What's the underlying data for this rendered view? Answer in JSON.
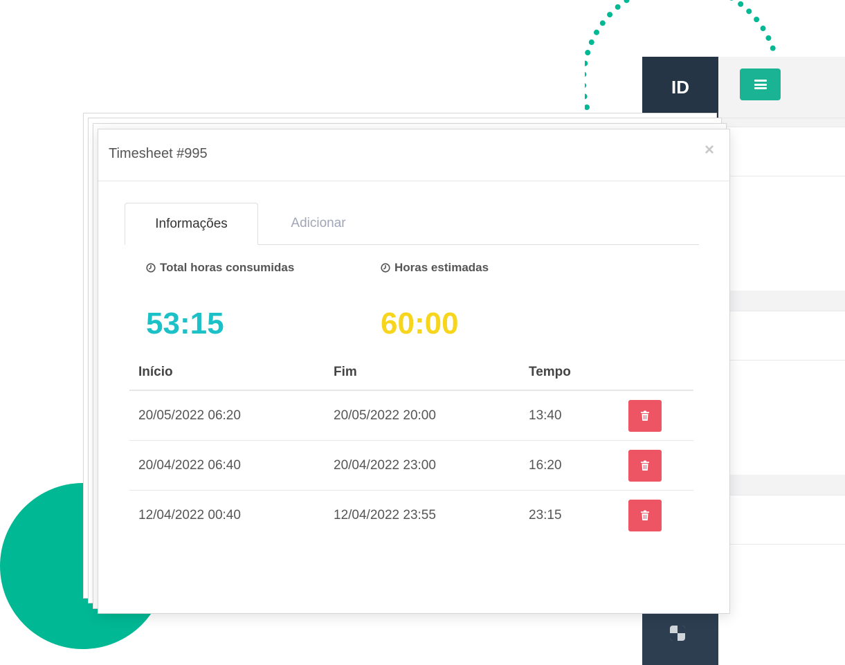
{
  "background_app": {
    "logo_text": "ID",
    "menu_icon": "hamburger-icon",
    "sidebar_icon": "dashboard-icon",
    "accent_color": "#1ab394",
    "sidebar_color": "#2c3e50"
  },
  "modal": {
    "title": "Timesheet #995",
    "close_label": "×",
    "tabs": [
      {
        "label": "Informações",
        "active": true
      },
      {
        "label": "Adicionar",
        "active": false
      }
    ],
    "stats": {
      "consumed": {
        "label": "Total horas consumidas",
        "value": "53:15",
        "icon": "clock-icon",
        "color": "#1cc1c8"
      },
      "estimated": {
        "label": "Horas estimadas",
        "value": "60:00",
        "icon": "clock-icon",
        "color": "#f7d51d"
      }
    },
    "table": {
      "headers": {
        "inicio": "Início",
        "fim": "Fim",
        "tempo": "Tempo"
      },
      "rows": [
        {
          "inicio": "20/05/2022 06:20",
          "fim": "20/05/2022 20:00",
          "tempo": "13:40"
        },
        {
          "inicio": "20/04/2022 06:40",
          "fim": "20/04/2022 23:00",
          "tempo": "16:20"
        },
        {
          "inicio": "12/04/2022 00:40",
          "fim": "12/04/2022 23:55",
          "tempo": "23:15"
        }
      ],
      "delete_icon": "trash-icon",
      "delete_color": "#ed5565"
    }
  },
  "decorations": {
    "circle_color": "#00b894",
    "dots_color": "#00b894"
  }
}
